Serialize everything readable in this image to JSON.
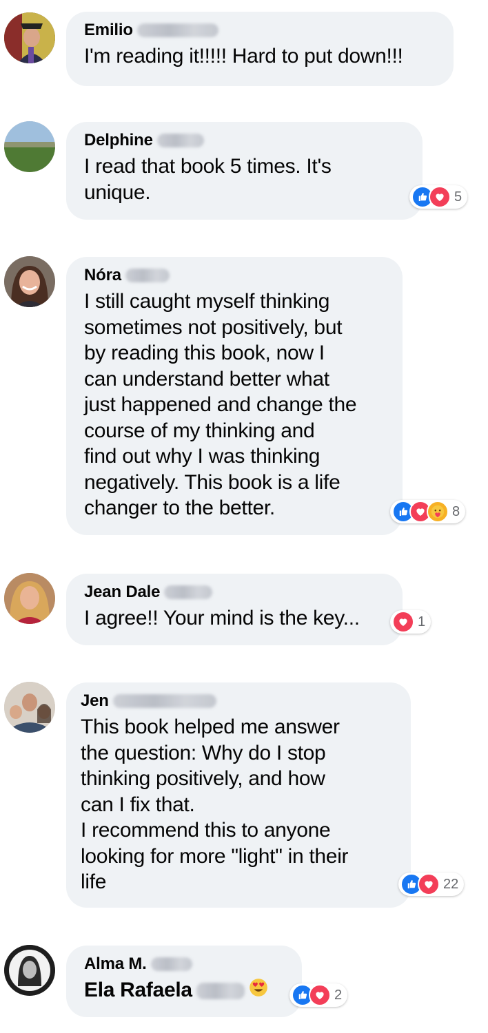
{
  "comments": [
    {
      "name": "Emilio",
      "text": "I'm reading it!!!!! Hard to put down!!!",
      "reactions": []
    },
    {
      "name": "Delphine",
      "text": "I read that book 5 times. It's\nunique.",
      "reactions": [
        "like-icon",
        "love-icon"
      ],
      "reaction_count": "5"
    },
    {
      "name": "Nóra",
      "text": "I still caught myself thinking\nsometimes not positively, but\nby reading this book, now I\ncan understand better what\njust happened and change the\ncourse of my thinking and\nfind out why I was thinking\nnegatively. This book is a life\nchanger to the better.",
      "reactions": [
        "like-icon",
        "love-icon",
        "care-icon"
      ],
      "reaction_count": "8"
    },
    {
      "name": "Jean Dale",
      "text": "I agree!! Your mind is the key...",
      "reactions": [
        "love-icon"
      ],
      "reaction_count": "1"
    },
    {
      "name": "Jen",
      "text": "This book helped me answer\nthe question: Why do I stop\nthinking positively, and how\ncan I fix that.\nI recommend this to anyone\nlooking for more \"light\" in their\nlife",
      "reactions": [
        "like-icon",
        "love-icon"
      ],
      "reaction_count": "22"
    },
    {
      "name": "Alma M.",
      "text": "Ela Rafaela",
      "text_emoji": "heart-eyes-icon",
      "reactions": [
        "like-icon",
        "love-icon"
      ],
      "reaction_count": "2"
    }
  ],
  "colors": {
    "bubble": "#eff2f5",
    "like": "#1877f2",
    "love": "#f33e58",
    "care": "#f7b125",
    "count": "#65676b"
  }
}
